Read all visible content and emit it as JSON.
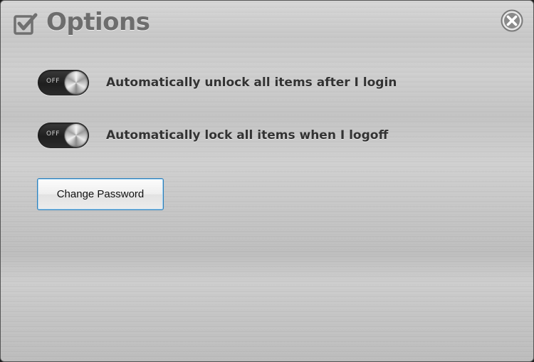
{
  "window": {
    "title": "Options"
  },
  "icons": {
    "title": "checkbox-checked-icon",
    "close": "close-circle-icon"
  },
  "options": [
    {
      "toggle_state": "OFF",
      "label": "Automatically unlock all items after I login"
    },
    {
      "toggle_state": "OFF",
      "label": "Automatically lock all items when I logoff"
    }
  ],
  "buttons": {
    "change_password": "Change Password"
  },
  "colors": {
    "title_text": "#6d6d6d",
    "label_text": "#333333",
    "button_focus_border": "#2e7fb8",
    "toggle_track": "#1f1f1f"
  }
}
